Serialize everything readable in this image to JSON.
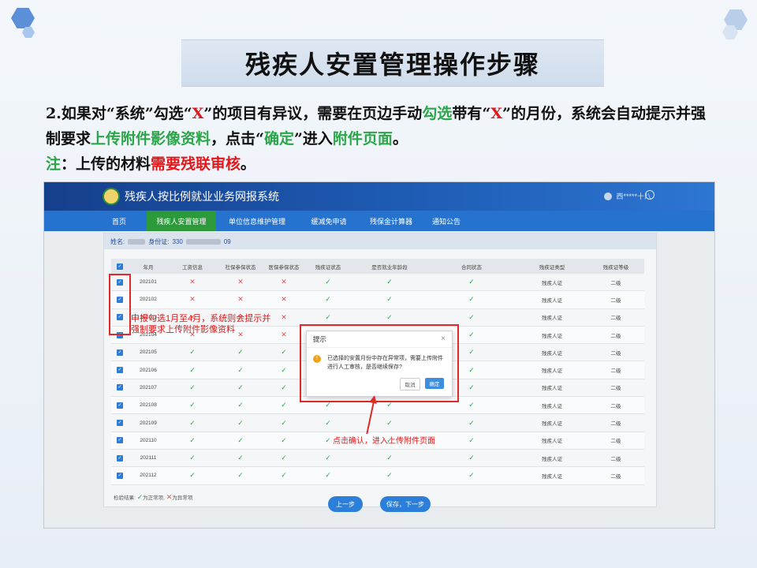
{
  "slide": {
    "title": "残疾人安置管理操作步骤",
    "desc": {
      "p1": "2.如果对“系统”勾选“",
      "x1": "X",
      "p2": "”的项目有异议，需要在页边手动",
      "g1": "勾选",
      "p3": "带有“",
      "x2": "X",
      "p4": "”的月份，系统会自动提示并强制要求",
      "g2": "上传附件影像资料",
      "p5": "，点击“",
      "g3": "确定",
      "p6": "”进入",
      "g4": "附件页面",
      "p7": "。",
      "note_label": "注",
      "p8": "：上传的材料",
      "r1": "需要残联审核",
      "p9": "。"
    }
  },
  "app": {
    "title": "残疾人按比例就业业务网报系统",
    "user": "西*****十八",
    "nav": [
      "首页",
      "残疾人安置管理",
      "单位信息维护管理",
      "缓减免申请",
      "残保金计算器",
      "通知公告"
    ],
    "info": {
      "name_label": "姓名:",
      "id_label": "身份证:",
      "id_start": "330",
      "id_end": "09"
    },
    "table": {
      "headers": [
        "年月",
        "工资信息",
        "社保参保状态",
        "医保参保状态",
        "残疾证状态",
        "是否就业年龄段",
        "合同状态",
        "残疾证类型",
        "残疾证等级"
      ],
      "rows": [
        {
          "month": "202101",
          "s": [
            "x",
            "x",
            "x",
            "ok",
            "ok",
            "ok"
          ],
          "type": "残疾人证",
          "level": "二级"
        },
        {
          "month": "202102",
          "s": [
            "x",
            "x",
            "x",
            "ok",
            "ok",
            "ok"
          ],
          "type": "残疾人证",
          "level": "二级"
        },
        {
          "month": "202103",
          "s": [
            "x",
            "x",
            "x",
            "ok",
            "ok",
            "ok"
          ],
          "type": "残疾人证",
          "level": "二级"
        },
        {
          "month": "202104",
          "s": [
            "x",
            "x",
            "x",
            "ok",
            "ok",
            "ok"
          ],
          "type": "残疾人证",
          "level": "二级"
        },
        {
          "month": "202105",
          "s": [
            "ok",
            "ok",
            "ok",
            "ok",
            "ok",
            "ok"
          ],
          "type": "残疾人证",
          "level": "二级"
        },
        {
          "month": "202106",
          "s": [
            "ok",
            "ok",
            "ok",
            "ok",
            "ok",
            "ok"
          ],
          "type": "残疾人证",
          "level": "二级"
        },
        {
          "month": "202107",
          "s": [
            "ok",
            "ok",
            "ok",
            "ok",
            "ok",
            "ok"
          ],
          "type": "残疾人证",
          "level": "二级"
        },
        {
          "month": "202108",
          "s": [
            "ok",
            "ok",
            "ok",
            "ok",
            "ok",
            "ok"
          ],
          "type": "残疾人证",
          "level": "二级"
        },
        {
          "month": "202109",
          "s": [
            "ok",
            "ok",
            "ok",
            "ok",
            "ok",
            "ok"
          ],
          "type": "残疾人证",
          "level": "二级"
        },
        {
          "month": "202110",
          "s": [
            "ok",
            "ok",
            "ok",
            "ok",
            "ok",
            "ok"
          ],
          "type": "残疾人证",
          "level": "二级"
        },
        {
          "month": "202111",
          "s": [
            "ok",
            "ok",
            "ok",
            "ok",
            "ok",
            "ok"
          ],
          "type": "残疾人证",
          "level": "二级"
        },
        {
          "month": "202112",
          "s": [
            "ok",
            "ok",
            "ok",
            "ok",
            "ok",
            "ok"
          ],
          "type": "残疾人证",
          "level": "二级"
        }
      ]
    },
    "legend": {
      "label": "检验结果:",
      "ok_text": "为正常项,",
      "x_text": "为异常项"
    },
    "modal": {
      "title": "提示",
      "body": "已选择的安置月份中存在异常项，需要上传附件进行人工审核，是否继续保存?",
      "cancel": "取消",
      "confirm": "确定"
    },
    "buttons": {
      "prev": "上一步",
      "next": "保存，下一步"
    }
  },
  "annotations": {
    "left_note": "申报勾选1月至4月，系统则会提示并强制要求上传附件影像资料",
    "bottom_note": "点击确认，进入上传附件页面"
  },
  "icons": {
    "check": "✓",
    "cross": "✕",
    "warn": "!",
    "close": "×"
  },
  "colors": {
    "nav_blue": "#2673cf",
    "active_green": "#2c9a3a",
    "highlight_red": "#e02a2a",
    "accent_green": "#2aa548"
  }
}
